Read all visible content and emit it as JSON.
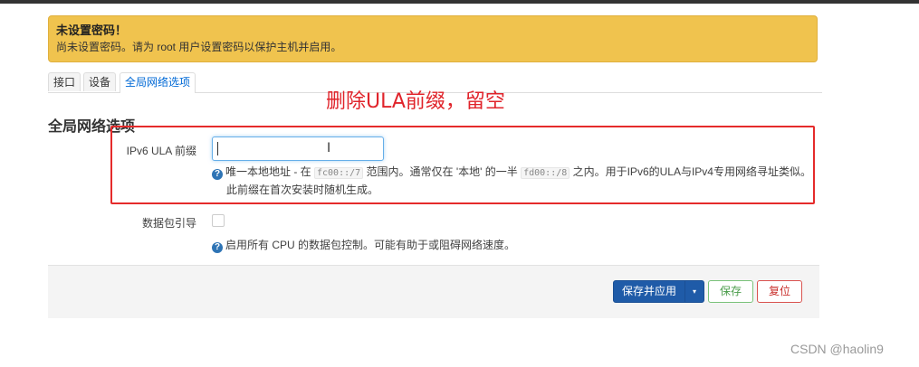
{
  "alert": {
    "title": "未设置密码！",
    "message": "尚未设置密码。请为 root 用户设置密码以保护主机并启用。"
  },
  "tabs": [
    {
      "label": "接口"
    },
    {
      "label": "设备"
    },
    {
      "label": "全局网络选项",
      "active": true
    }
  ],
  "annotation": "删除ULA前缀，留空",
  "section_title": "全局网络选项",
  "fields": {
    "ula": {
      "label": "IPv6 ULA 前缀",
      "value": "",
      "help_pre": "唯一本地地址 - 在 ",
      "help_code1": "fc00::/7",
      "help_mid": " 范围内。通常仅在 '本地' 的一半 ",
      "help_code2": "fd00::/8",
      "help_post": " 之内。用于IPv6的ULA与IPv4专用网络寻址类似。",
      "help_line2": "此前缀在首次安装时随机生成。"
    },
    "packet_steering": {
      "label": "数据包引导",
      "checked": false,
      "help": "启用所有 CPU 的数据包控制。可能有助于或阻碍网络速度。"
    }
  },
  "footer": {
    "save_apply": "保存并应用",
    "dropdown_icon": "▾",
    "save": "保存",
    "reset": "复位"
  },
  "watermark": "CSDN @haolin9",
  "colors": {
    "alert_bg": "#f0c34e",
    "annotation_red": "#e0242b",
    "primary_blue": "#1f5ba8",
    "save_green": "#4a9c4a",
    "reset_red": "#c9302c"
  }
}
